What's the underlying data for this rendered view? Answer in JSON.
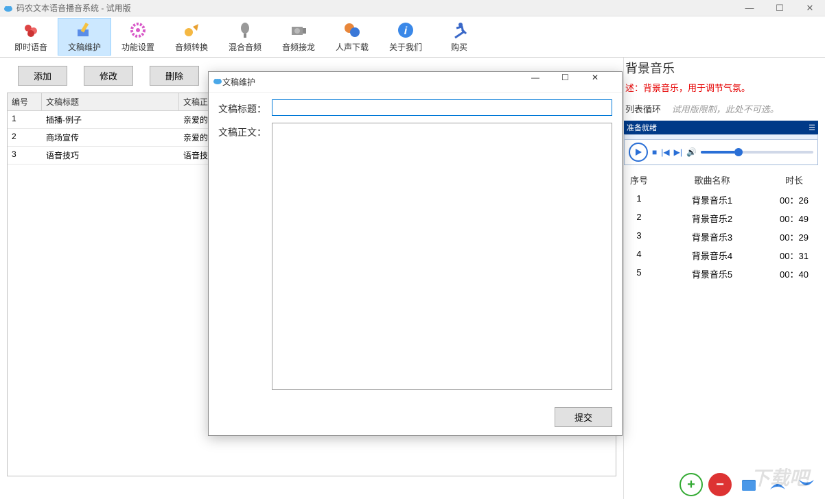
{
  "window": {
    "title": "码农文本语音播音系统 - 试用版"
  },
  "toolbar": [
    {
      "id": "instant",
      "label": "即时语音"
    },
    {
      "id": "maintain",
      "label": "文稿维护"
    },
    {
      "id": "settings",
      "label": "功能设置"
    },
    {
      "id": "convert",
      "label": "音频转换"
    },
    {
      "id": "mix",
      "label": "混合音频"
    },
    {
      "id": "relay",
      "label": "音频接龙"
    },
    {
      "id": "download",
      "label": "人声下载"
    },
    {
      "id": "about",
      "label": "关于我们"
    },
    {
      "id": "buy",
      "label": "购买"
    }
  ],
  "buttons": {
    "add": "添加",
    "edit": "修改",
    "delete": "删除",
    "submit": "提交"
  },
  "grid": {
    "headers": {
      "id": "编号",
      "title": "文稿标题",
      "body": "文稿正文"
    },
    "rows": [
      {
        "id": "1",
        "title": "插播-例子",
        "body": "亲爱的"
      },
      {
        "id": "2",
        "title": "商场宣传",
        "body": "亲爱的"
      },
      {
        "id": "3",
        "title": "语音技巧",
        "body": "语音技"
      }
    ]
  },
  "right": {
    "title": "背景音乐",
    "desc": "述：背景音乐，用于调节气氛。",
    "loop": "列表循环",
    "hint": "试用版限制，此处不可选。",
    "status": "准备就绪",
    "headers": {
      "id": "序号",
      "name": "歌曲名称",
      "dur": "时长"
    },
    "songs": [
      {
        "id": "1",
        "name": "背景音乐1",
        "dur": "00：26"
      },
      {
        "id": "2",
        "name": "背景音乐2",
        "dur": "00：49"
      },
      {
        "id": "3",
        "name": "背景音乐3",
        "dur": "00：29"
      },
      {
        "id": "4",
        "name": "背景音乐4",
        "dur": "00：31"
      },
      {
        "id": "5",
        "name": "背景音乐5",
        "dur": "00：40"
      }
    ]
  },
  "dialog": {
    "title": "文稿维护",
    "label_title": "文稿标题：",
    "label_body": "文稿正文：",
    "value_title": "",
    "value_body": ""
  },
  "watermark": "下载吧"
}
